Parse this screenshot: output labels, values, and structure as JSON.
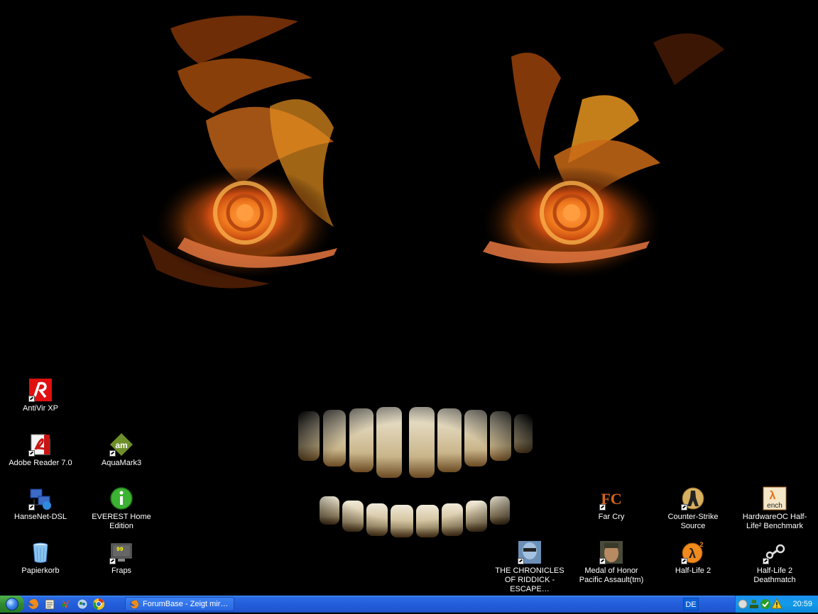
{
  "desktop": {
    "icons": [
      {
        "label": "AntiVir XP",
        "icon": "antivir-icon"
      },
      {
        "label": "Adobe Reader 7.0",
        "icon": "adobe-reader-icon"
      },
      {
        "label": "AquaMark3",
        "icon": "aquamark-icon"
      },
      {
        "label": "HanseNet-DSL",
        "icon": "network-connection-icon"
      },
      {
        "label": "EVEREST Home Edition",
        "icon": "everest-info-icon"
      },
      {
        "label": "Papierkorb",
        "icon": "recycle-bin-icon"
      },
      {
        "label": "Fraps",
        "icon": "fraps-icon"
      },
      {
        "label": "Far Cry",
        "icon": "far-cry-icon"
      },
      {
        "label": "Counter-Strike Source",
        "icon": "counter-strike-icon"
      },
      {
        "label": "HardwareOC Half-Life² Benchmark",
        "icon": "hl2-bench-icon"
      },
      {
        "label": "THE CHRONICLES OF RIDDICK - ESCAPE…",
        "icon": "riddick-icon"
      },
      {
        "label": "Medal of Honor Pacific Assault(tm)",
        "icon": "medal-of-honor-icon"
      },
      {
        "label": "Half-Life 2",
        "icon": "half-life-2-icon"
      },
      {
        "label": "Half-Life 2 Deathmatch",
        "icon": "steam-icon"
      }
    ]
  },
  "taskbar": {
    "quick_launch": [
      "show-desktop-icon",
      "firefox-icon",
      "notepad-icon",
      "msn-icon",
      "messenger-icon",
      "chrome-like-icon"
    ],
    "tasks": [
      {
        "label": "ForumBase - Zeigt mir…",
        "icon": "firefox-icon"
      }
    ],
    "language": "DE",
    "tray_icons": [
      "volume-icon",
      "network-icon",
      "antivir-tray-icon",
      "security-warning-icon"
    ],
    "clock": "20:59"
  },
  "colors": {
    "taskbar_blue": "#245edb",
    "start_green": "#2f8a2f",
    "tray_blue": "#129be9"
  }
}
